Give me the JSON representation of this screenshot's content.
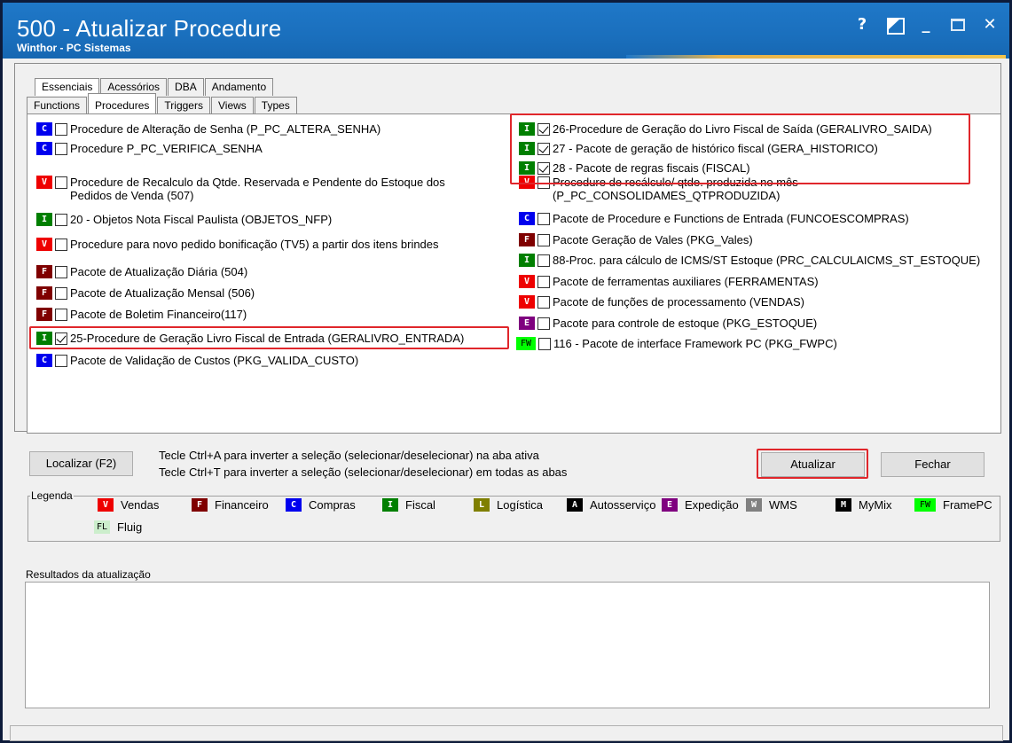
{
  "window": {
    "title": "500 - Atualizar Procedure",
    "subtitle": "Winthor - PC Sistemas",
    "controls": {
      "help": "?",
      "minimize": "_",
      "close": "✕"
    }
  },
  "tabs": {
    "row1": [
      "Essenciais",
      "Acessórios",
      "DBA",
      "Andamento"
    ],
    "row2": [
      "Functions",
      "Procedures",
      "Triggers",
      "Views",
      "Types"
    ],
    "active_row1": "Essenciais",
    "active_row2": "Procedures"
  },
  "badge_colors": {
    "C": "#0000ee",
    "V": "#ee0000",
    "F": "#7f0000",
    "I": "#007f00",
    "E": "#7f007f",
    "FW": "#00ff00",
    "L": "#7f7f00",
    "A": "#000000",
    "W": "#808080",
    "M": "#000000",
    "FL": "#cceecc"
  },
  "left_items": [
    {
      "badge": "C",
      "checked": false,
      "label": "Procedure de Alteração de Senha (P_PC_ALTERA_SENHA)"
    },
    {
      "badge": "C",
      "checked": false,
      "label": "Procedure P_PC_VERIFICA_SENHA"
    },
    {
      "badge": "V",
      "checked": false,
      "label": "Procedure de Recalculo da Qtde. Reservada e Pendente do Estoque dos Pedidos de Venda (507)"
    },
    {
      "badge": "I",
      "checked": false,
      "label": "20 - Objetos Nota Fiscal Paulista (OBJETOS_NFP)"
    },
    {
      "badge": "V",
      "checked": false,
      "label": "Procedure para novo pedido bonificação (TV5) a partir dos itens brindes"
    },
    {
      "badge": "F",
      "checked": false,
      "label": "Pacote de Atualização Diária (504)"
    },
    {
      "badge": "F",
      "checked": false,
      "label": "Pacote de Atualização Mensal (506)"
    },
    {
      "badge": "F",
      "checked": false,
      "label": "Pacote de Boletim Financeiro(117)"
    },
    {
      "badge": "I",
      "checked": true,
      "label": "25-Procedure de Geração Livro Fiscal de Entrada (GERALIVRO_ENTRADA)"
    },
    {
      "badge": "C",
      "checked": false,
      "label": "Pacote de Validação de Custos (PKG_VALIDA_CUSTO)"
    }
  ],
  "right_items": [
    {
      "badge": "I",
      "checked": true,
      "label": "26-Procedure de Geração do Livro Fiscal de Saída (GERALIVRO_SAIDA)"
    },
    {
      "badge": "I",
      "checked": true,
      "label": "27 - Pacote de geração de histórico fiscal (GERA_HISTORICO)"
    },
    {
      "badge": "I",
      "checked": true,
      "label": "28 - Pacote de regras fiscais (FISCAL)"
    },
    {
      "badge": "V",
      "checked": false,
      "label": "Procedure de recálculo/ qtde. produzida no mês (P_PC_CONSOLIDAMES_QTPRODUZIDA)"
    },
    {
      "badge": "C",
      "checked": false,
      "label": "Pacote de Procedure e Functions de Entrada (FUNCOESCOMPRAS)"
    },
    {
      "badge": "F",
      "checked": false,
      "label": "Pacote Geração de Vales (PKG_Vales)"
    },
    {
      "badge": "I",
      "checked": false,
      "label": "88-Proc. para cálculo de ICMS/ST Estoque (PRC_CALCULAICMS_ST_ESTOQUE)"
    },
    {
      "badge": "V",
      "checked": false,
      "label": "Pacote de ferramentas auxiliares (FERRAMENTAS)"
    },
    {
      "badge": "V",
      "checked": false,
      "label": "Pacote de funções de processamento (VENDAS)"
    },
    {
      "badge": "E",
      "checked": false,
      "label": "Pacote para controle de estoque (PKG_ESTOQUE)"
    },
    {
      "badge": "FW",
      "checked": false,
      "label": "116 - Pacote de interface Framework PC (PKG_FWPC)"
    }
  ],
  "actions": {
    "localizar": "Localizar (F2)",
    "hint1": "Tecle Ctrl+A para inverter a seleção (selecionar/deselecionar) na aba ativa",
    "hint2": "Tecle Ctrl+T para inverter a seleção (selecionar/deselecionar) em todas as abas",
    "atualizar": "Atualizar",
    "fechar": "Fechar"
  },
  "legend": {
    "title": "Legenda",
    "items": [
      {
        "badge": "V",
        "label": "Vendas"
      },
      {
        "badge": "F",
        "label": "Financeiro"
      },
      {
        "badge": "C",
        "label": "Compras"
      },
      {
        "badge": "I",
        "label": "Fiscal"
      },
      {
        "badge": "L",
        "label": "Logística"
      },
      {
        "badge": "A",
        "label": "Autosserviço"
      },
      {
        "badge": "E",
        "label": "Expedição"
      },
      {
        "badge": "W",
        "label": "WMS"
      },
      {
        "badge": "M",
        "label": "MyMix"
      },
      {
        "badge": "FW",
        "label": "FramePC"
      },
      {
        "badge": "FL",
        "label": "Fluig"
      }
    ]
  },
  "results": {
    "title": "Resultados da atualização"
  }
}
